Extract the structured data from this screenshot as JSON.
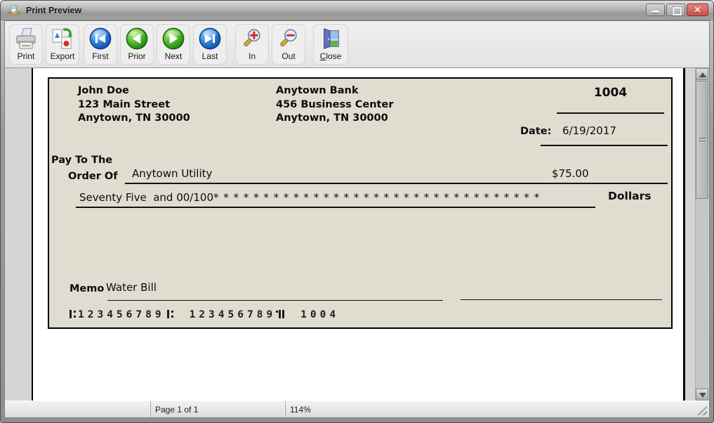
{
  "window": {
    "title": "Print Preview",
    "titlebar_icon": "print-preview-icon",
    "controls": [
      {
        "name": "minimize-button",
        "icon": "minimize-icon"
      },
      {
        "name": "restore-button",
        "icon": "restore-icon"
      },
      {
        "name": "close-button",
        "icon": "close-x-icon",
        "glyph": "✕"
      }
    ]
  },
  "toolbar": {
    "buttons": [
      {
        "label": "Print",
        "icon": "printer-icon"
      },
      {
        "label": "Export",
        "icon": "export-icon"
      },
      {
        "label": "First",
        "icon": "first-page-icon"
      },
      {
        "label": "Prior",
        "icon": "prior-page-icon"
      },
      {
        "label": "Next",
        "icon": "next-page-icon"
      },
      {
        "label": "Last",
        "icon": "last-page-icon"
      },
      {
        "label": "In",
        "icon": "zoom-in-icon"
      },
      {
        "label": "Out",
        "icon": "zoom-out-icon"
      },
      {
        "label_prefix": "C",
        "label_rest": "lose",
        "icon": "close-door-icon"
      }
    ]
  },
  "check": {
    "payer_name": "John Doe",
    "payer_address1": "123 Main Street",
    "payer_address2": "Anytown, TN 30000",
    "bank_name": "Anytown Bank",
    "bank_address1": "456 Business Center",
    "bank_address2": "Anytown, TN 30000",
    "check_number": "1004",
    "date_label": "Date:",
    "date_value": "6/19/2017",
    "pay_to_label_line1": "Pay To The",
    "pay_to_label_line2": "Order Of",
    "payee": "Anytown Utility",
    "amount": "$75.00",
    "amount_words": "Seventy Five  and 00/100",
    "amount_fill": "* * * * * * * * * * * * * * * * * * * * * * * * * * * * * * * * *",
    "dollars_label": "Dollars",
    "memo_label": "Memo",
    "memo_value": "Water Bill",
    "micr_routing": "123456789",
    "micr_account": "123456789",
    "micr_check_number": "1004"
  },
  "statusbar": {
    "page_info": "Page 1 of 1",
    "zoom_level": "114%"
  },
  "colors": {
    "check_background": "#dfddd0",
    "nav_blue": "#1662c4",
    "nav_green": "#2f9e22",
    "close_button_red": "#c6504a",
    "accent_red": "#d92b20"
  }
}
